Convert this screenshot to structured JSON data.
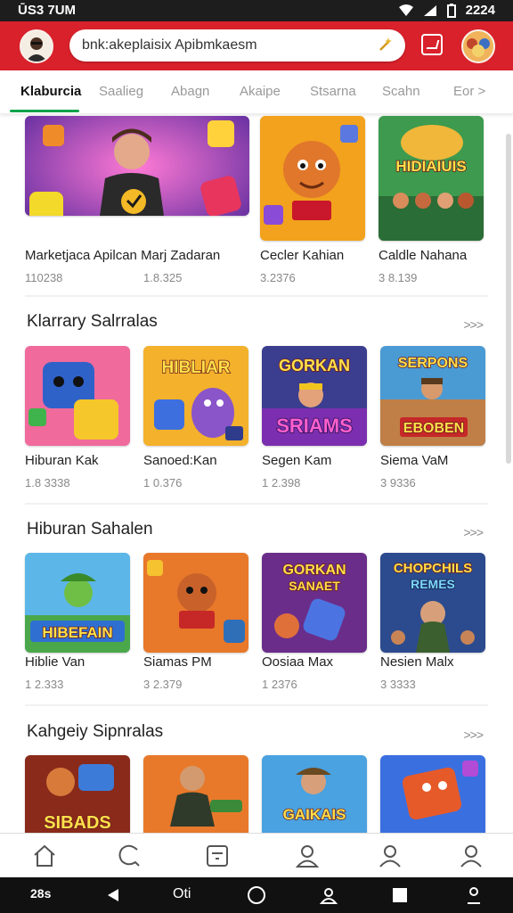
{
  "status": {
    "time": "ŪS3 7UM",
    "battery": "2224"
  },
  "search": {
    "text": "bnk:akeplaisix Apibmkaesm"
  },
  "tabs": [
    {
      "label": "Klaburcia",
      "active": true
    },
    {
      "label": "Saalieg"
    },
    {
      "label": "Abagn"
    },
    {
      "label": "Akaipe"
    },
    {
      "label": "Stsarna"
    },
    {
      "label": "Scahn"
    },
    {
      "label": "Eor >"
    }
  ],
  "sections": [
    {
      "title": "",
      "cards": [
        {
          "name": "Marketjaca Apilcan Marj Zadaran",
          "meta": "110238"
        },
        {
          "name": "Cecler Kahian",
          "meta": "3.2376"
        },
        {
          "name": "Caldle Nahana",
          "meta": "3 8.139"
        }
      ],
      "extra_meta": "1.8.325"
    },
    {
      "title": "Klarrary Salrralas",
      "more": ">>>",
      "cards": [
        {
          "name": "Hiburan Kak",
          "meta": "1.8 3338",
          "thumb_text": ""
        },
        {
          "name": "Sanoed:Kan",
          "meta": "1 0.376",
          "thumb_text": "HIBLIAR"
        },
        {
          "name": "Segen Kam",
          "meta": "1 2.398",
          "thumb_text": "SRIAMS"
        },
        {
          "name": "Siema VaM",
          "meta": "3 9336",
          "thumb_text": "SERPONS"
        }
      ]
    },
    {
      "title": "Hiburan Sahalen",
      "more": ">>>",
      "cards": [
        {
          "name": "Hiblie Van",
          "meta": "1 2.333",
          "thumb_text": "HIBEFAIN"
        },
        {
          "name": "Siamas PM",
          "meta": "3 2.379",
          "thumb_text": ""
        },
        {
          "name": "Oosiaa Max",
          "meta": "1 2376",
          "thumb_text": "GORKAN"
        },
        {
          "name": "Nesien Malx",
          "meta": "3 3333",
          "thumb_text": "CHOPCHILS"
        }
      ]
    },
    {
      "title": "Kahgeiy Sipnralas",
      "more": ">>>",
      "cards": [
        {
          "thumb_text": "SIBADS"
        },
        {
          "thumb_text": ""
        },
        {
          "thumb_text": "GAIKAIS"
        },
        {
          "thumb_text": ""
        }
      ]
    }
  ],
  "section1_thumbs": {
    "card2": "",
    "card3": "HIDIAIUIS"
  },
  "section2_thumbs_sub": {
    "card3": "SRIAMS",
    "card4": "EBOBEN"
  },
  "section3_thumbs_sub": {
    "card3": "SANAET",
    "card4": "REMES"
  },
  "bottom_nav": [
    {
      "icon": "home-icon"
    },
    {
      "icon": "chat-icon"
    },
    {
      "icon": "list-icon"
    },
    {
      "icon": "profile-icon"
    },
    {
      "icon": "user-icon"
    },
    {
      "icon": "account-icon"
    }
  ],
  "system_nav": {
    "left_text": "28s",
    "mid_text": "Oti"
  },
  "colors": {
    "brand": "#d9212b",
    "accent": "#0ba34a"
  }
}
